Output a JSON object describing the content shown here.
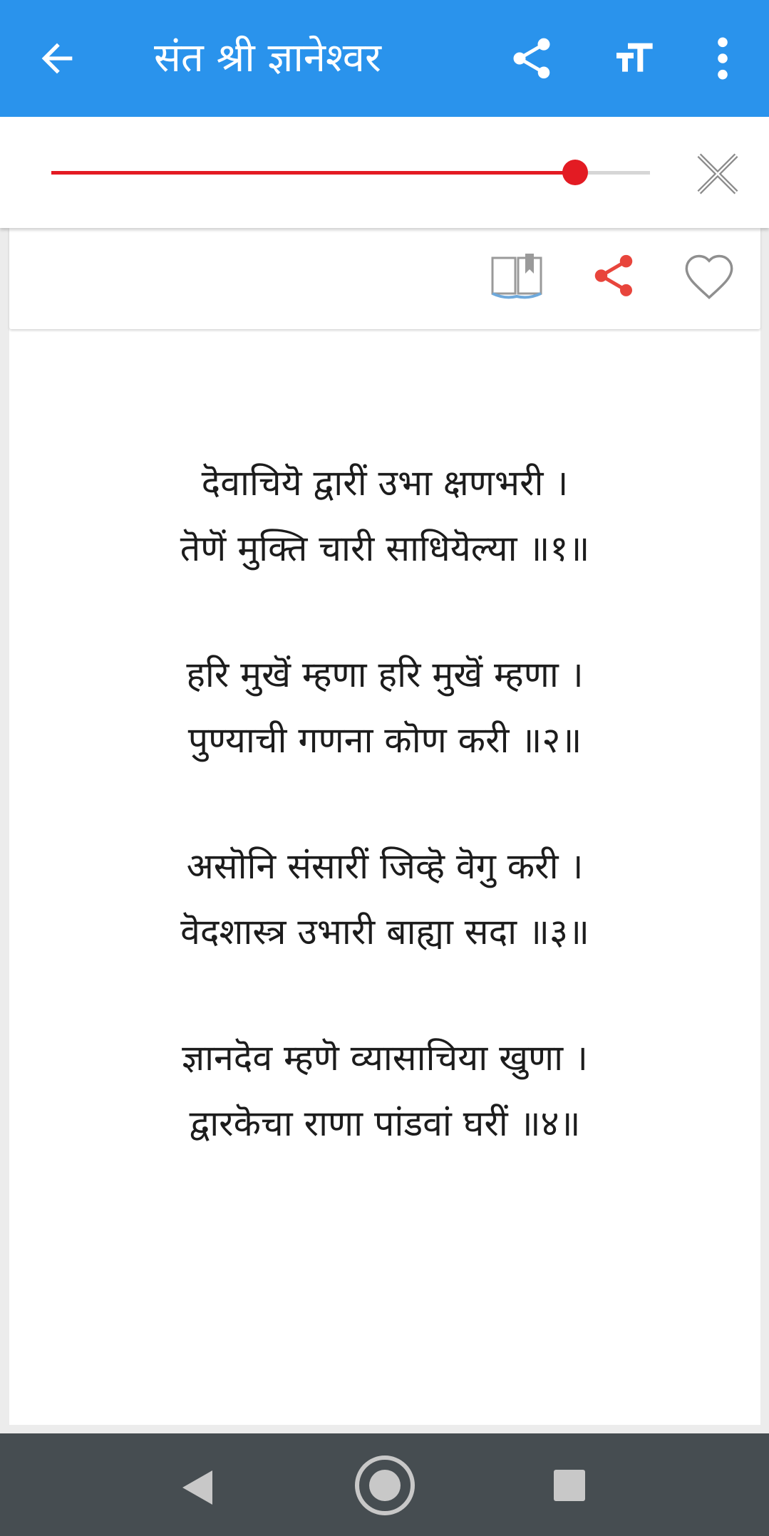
{
  "app_bar": {
    "title": "संत श्री ज्ञानेश्वर",
    "icons": [
      "arrow-back-icon",
      "share-icon",
      "text-size-icon",
      "more-vert-icon"
    ],
    "color": "#2a93ec"
  },
  "font_slider": {
    "value_fraction": 0.875,
    "accent_color": "#e31b23",
    "close_icon": "close-icon"
  },
  "card_actions": {
    "icons": [
      "book-bookmark-icon",
      "share-icon",
      "heart-outline-icon"
    ],
    "share_color": "#e8453c"
  },
  "verses": [
    {
      "line1": "दॆवाचियॆ द्वारीं उभा क्षणभरी ।",
      "line2": "तॆणॆं मुक्ति चारी साधियॆल्या ॥१॥"
    },
    {
      "line1": "हरि मुखॆं म्हणा हरि मुखॆं म्हणा ।",
      "line2": "पुण्याची गणना कॊण करी ॥२॥"
    },
    {
      "line1": "असॊनि संसारीं जिव्हॆ वॆगु करी ।",
      "line2": "वॆदशास्त्र उभारी बाह्या सदा ॥३॥"
    },
    {
      "line1": "ज्ञानदॆव म्हणॆ व्यासाचिया खुणा ।",
      "line2": "द्वारकॆचा राणा पांडवां घरीं ॥४॥"
    }
  ],
  "nav_bar": {
    "icons": [
      "nav-back-icon",
      "nav-home-icon",
      "nav-recents-icon"
    ]
  }
}
